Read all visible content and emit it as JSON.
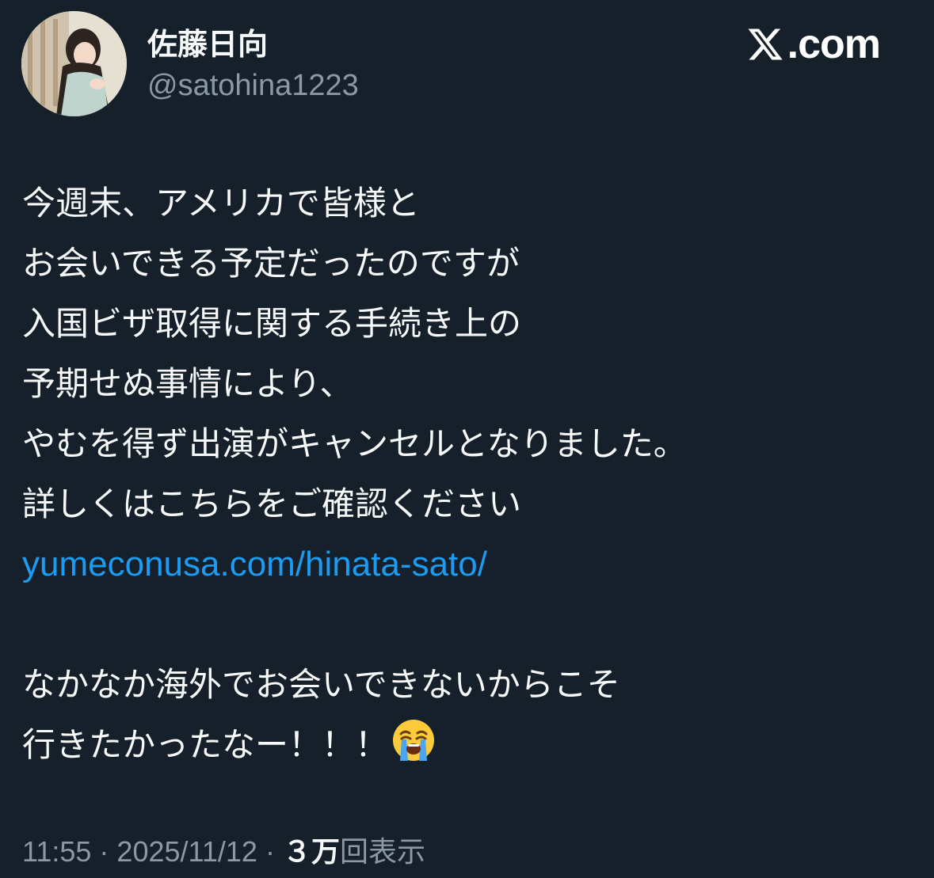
{
  "author": {
    "display_name": "佐藤日向",
    "handle": "@satohina1223"
  },
  "brand": {
    "logo_icon": "x-logo-icon",
    "text": ".com"
  },
  "tweet": {
    "lines_top": [
      "今週末、アメリカで皆様と",
      "お会いできる予定だったのですが",
      "入国ビザ取得に関する手続き上の",
      "予期せぬ事情により、",
      "やむを得ず出演がキャンセルとなりました。",
      "詳しくはこちらをご確認ください"
    ],
    "link": "yumeconusa.com/hinata-sato/",
    "lines_bottom": [
      "なかなか海外でお会いできないからこそ",
      "行きたかったなー！！！"
    ],
    "trailing_emoji": "loudly-crying-face-icon"
  },
  "meta": {
    "time": "11:55",
    "separator": "·",
    "date": "2025/11/12",
    "views_count": "３万",
    "views_label": "回表示"
  },
  "colors": {
    "background": "#15202b",
    "text": "#f7f9f9",
    "secondary": "#8b98a5",
    "link": "#1d9bf0"
  }
}
